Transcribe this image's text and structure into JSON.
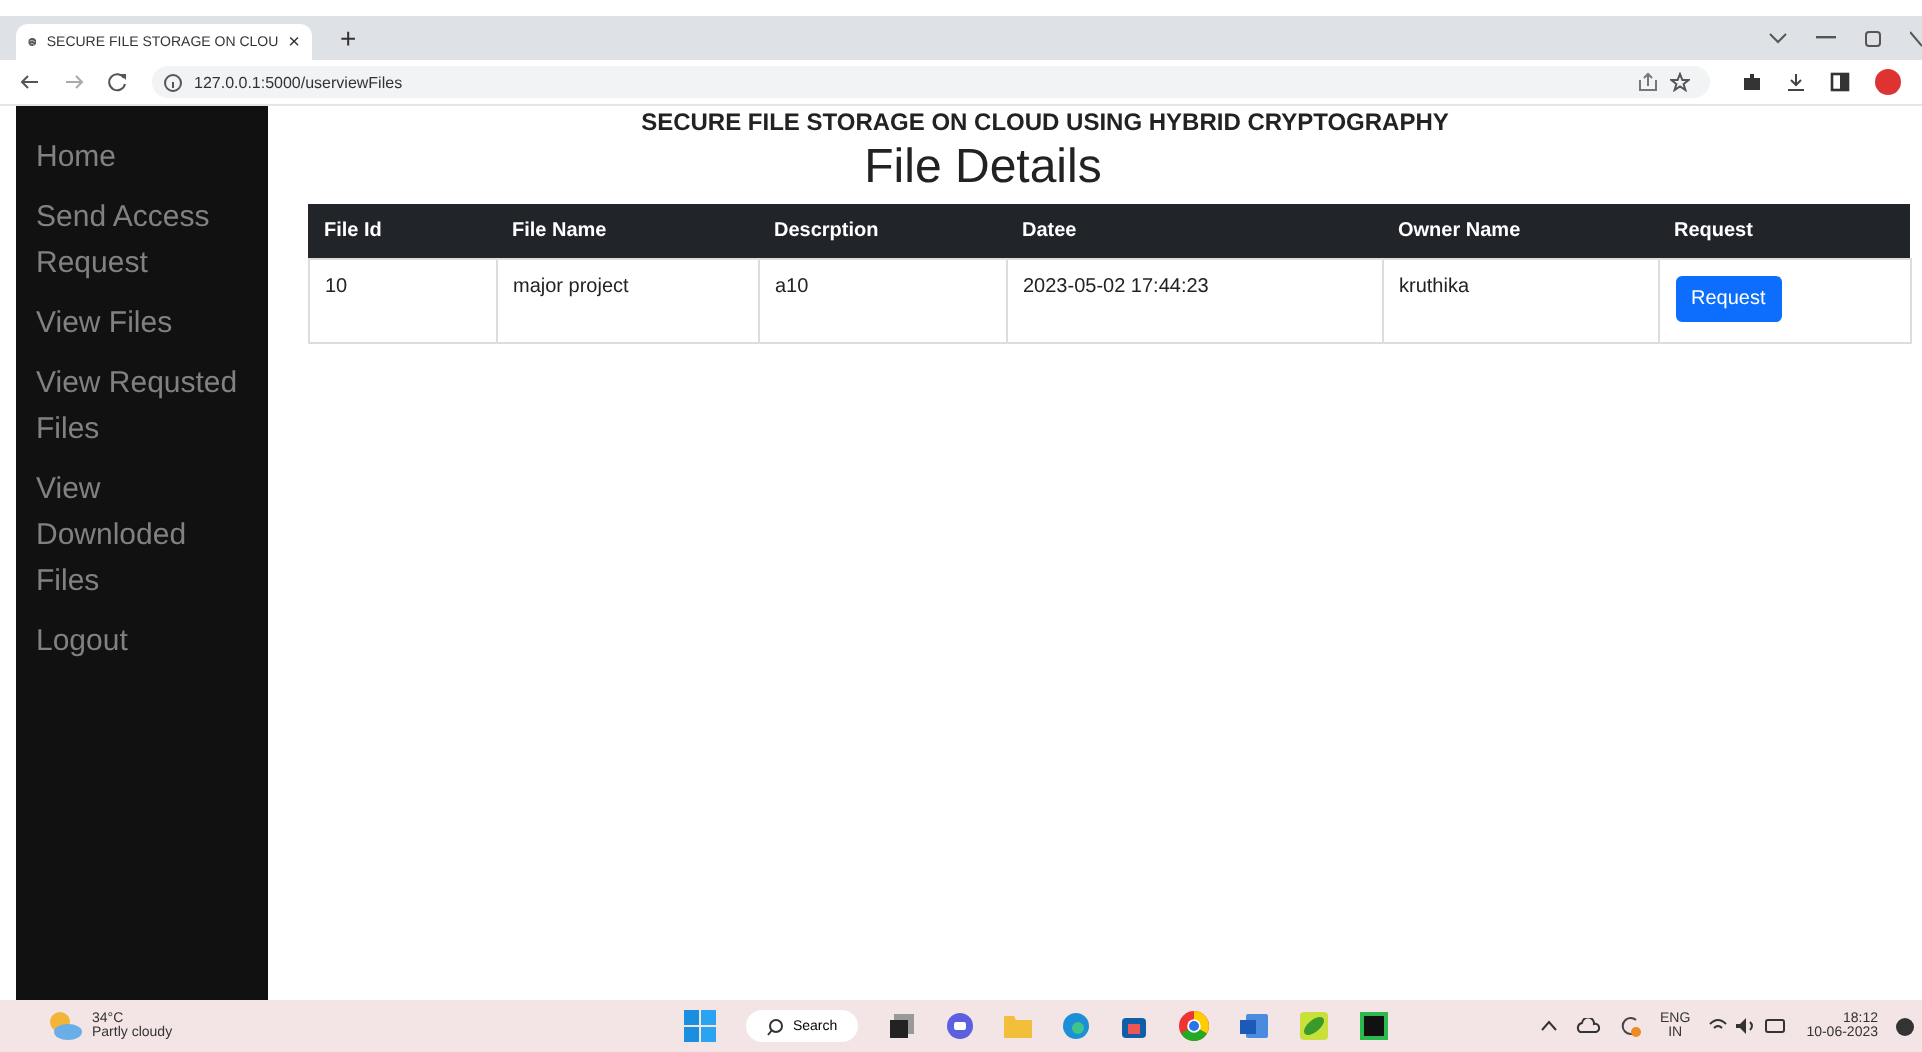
{
  "browser": {
    "tab_title": "SECURE FILE STORAGE ON CLOU",
    "tab_close": "×",
    "new_tab": "+",
    "url": "127.0.0.1:5000/userviewFiles"
  },
  "sidebar": {
    "items": [
      {
        "label": "Home"
      },
      {
        "label": "Send Access Request"
      },
      {
        "label": "View Files"
      },
      {
        "label": "View Requsted Files"
      },
      {
        "label": "View Downloded Files"
      },
      {
        "label": "Logout"
      }
    ]
  },
  "header": "SECURE FILE STORAGE ON CLOUD USING HYBRID CRYPTOGRAPHY",
  "title": "File Details",
  "table": {
    "columns": [
      "File Id",
      "File Name",
      "Descrption",
      "Datee",
      "Owner Name",
      "Request"
    ],
    "rows": [
      {
        "cells": [
          "10",
          "major project",
          "a10",
          "2023-05-02 17:44:23",
          "kruthika"
        ],
        "button": "Request"
      }
    ]
  },
  "taskbar": {
    "weather_temp": "34°C",
    "weather_text": "Partly cloudy",
    "search": "Search",
    "lang": "ENG",
    "region": "IN",
    "time": "18:12",
    "date": "10-06-2023"
  }
}
